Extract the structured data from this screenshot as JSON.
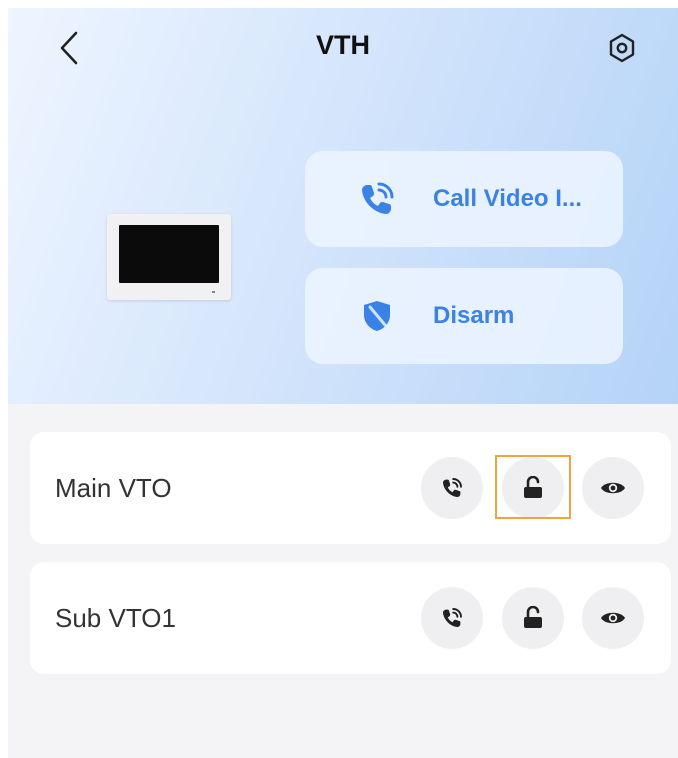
{
  "header": {
    "title": "VTH",
    "back_icon": "chevron-left-icon",
    "settings_icon": "gear-icon"
  },
  "actions": [
    {
      "label": "Call Video I...",
      "icon": "phone-call-icon",
      "color": "#3a82e6"
    },
    {
      "label": "Disarm",
      "icon": "shield-disarm-icon",
      "color": "#3a82e6"
    }
  ],
  "devices": [
    {
      "name": "Main VTO",
      "buttons": [
        "phone-call-icon",
        "unlock-icon",
        "eye-icon"
      ],
      "highlighted_button": "unlock-icon"
    },
    {
      "name": "Sub VTO1",
      "buttons": [
        "phone-call-icon",
        "unlock-icon",
        "eye-icon"
      ]
    }
  ],
  "colors": {
    "accent": "#3a82e6",
    "highlight": "#f0a43a",
    "background": "#f4f4f6"
  }
}
